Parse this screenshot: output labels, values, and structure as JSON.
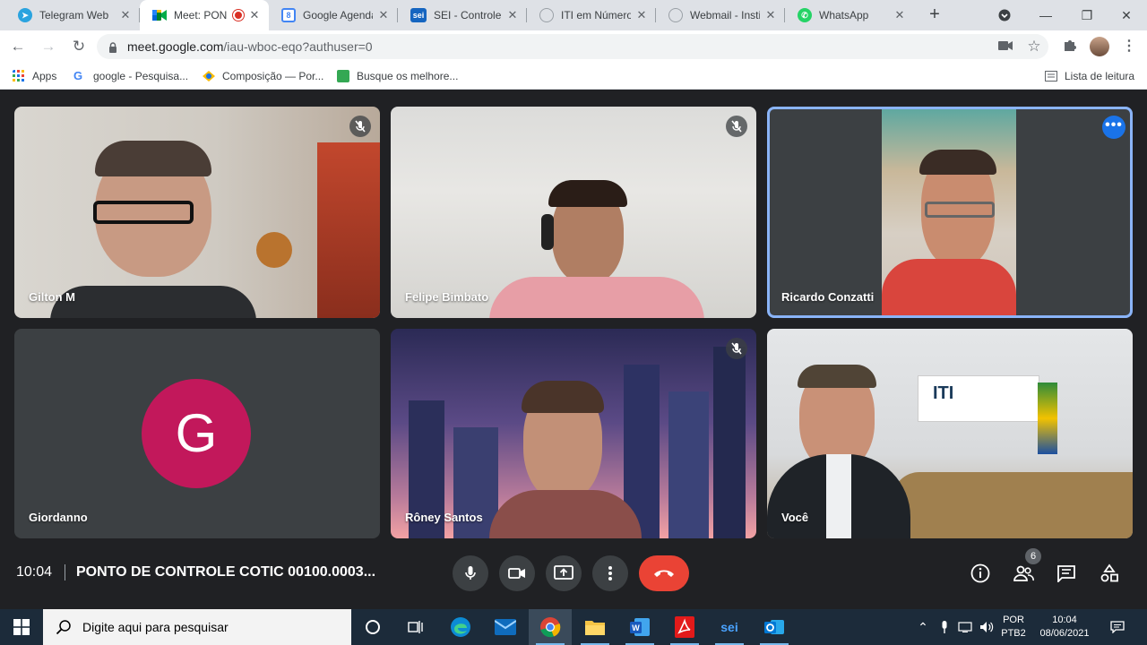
{
  "browser": {
    "tabs": [
      {
        "label": "Telegram Web",
        "icon": "telegram-icon",
        "color": "#2aa3df"
      },
      {
        "label": "Meet: PON",
        "icon": "google-meet-icon",
        "color": "#00832d",
        "active": true,
        "recording": true
      },
      {
        "label": "Google Agenda",
        "icon": "google-calendar-icon",
        "color": "#4285f4"
      },
      {
        "label": "SEI - Controle d",
        "icon": "sei-icon",
        "color": "#1565c0"
      },
      {
        "label": "ITI em Número",
        "icon": "fingerprint-icon",
        "color": "#9aa0a6"
      },
      {
        "label": "Webmail - Instit",
        "icon": "fingerprint-icon",
        "color": "#9aa0a6"
      },
      {
        "label": "WhatsApp",
        "icon": "whatsapp-icon",
        "color": "#25d366"
      }
    ],
    "url_host": "meet.google.com",
    "url_path": "/iau-wboc-eqo?authuser=0",
    "bookmarks": [
      {
        "label": "Apps",
        "icon": "apps-grid-icon"
      },
      {
        "label": "google - Pesquisa...",
        "icon": "google-icon"
      },
      {
        "label": "Composição — Por...",
        "icon": "brazil-flag-icon"
      },
      {
        "label": "Busque os melhore...",
        "icon": "bookmark-site-icon"
      }
    ],
    "reading_list_label": "Lista de leitura"
  },
  "meet": {
    "participants": [
      {
        "name": "Gilton M",
        "muted": true
      },
      {
        "name": "Felipe Bimbato",
        "muted": true
      },
      {
        "name": "Ricardo Conzatti",
        "muted": false,
        "speaking": true
      },
      {
        "name": "Giordanno",
        "initial": "G",
        "muted": false
      },
      {
        "name": "Rôney Santos",
        "muted": true
      },
      {
        "name": "Você",
        "muted": false
      }
    ],
    "time": "10:04",
    "meeting_title": "PONTO DE CONTROLE COTIC 00100.0003...",
    "participant_count": "6",
    "colors": {
      "hangup": "#ea4335",
      "avatar_g": "#c2185b",
      "active_border": "#8ab4f8"
    }
  },
  "taskbar": {
    "search_placeholder": "Digite aqui para pesquisar",
    "lang_top": "POR",
    "lang_bottom": "PTB2",
    "time": "10:04",
    "date": "08/06/2021"
  }
}
